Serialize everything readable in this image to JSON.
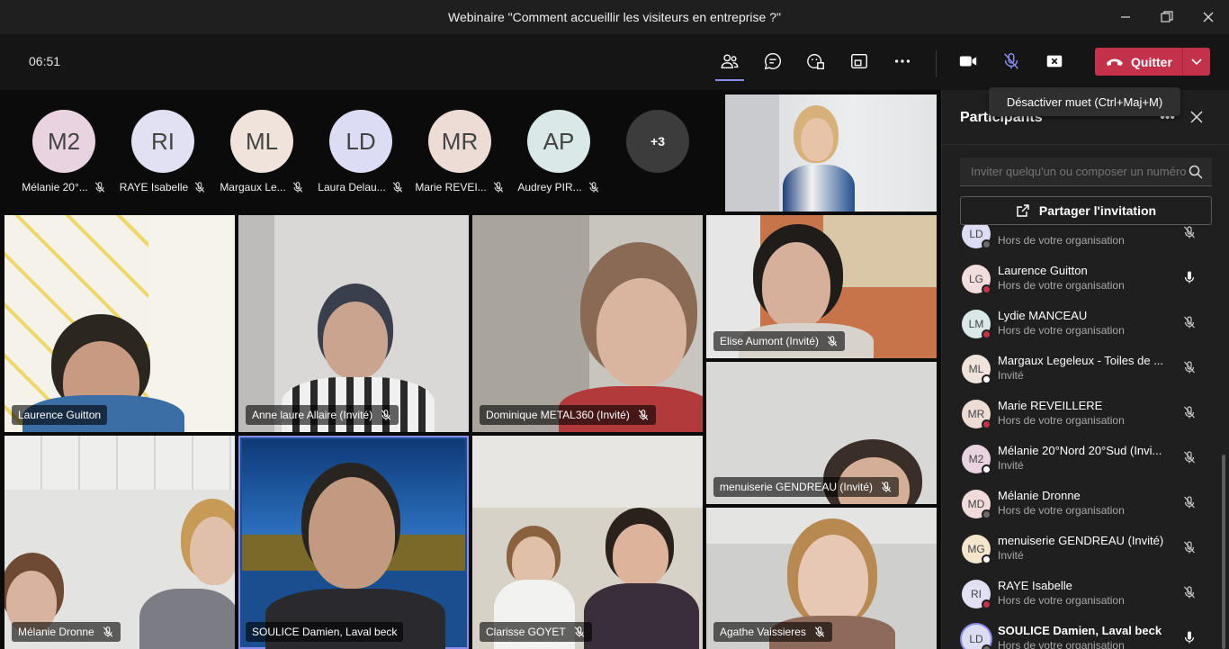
{
  "window": {
    "title": "Webinaire \"Comment accueillir les visiteurs en entreprise ?\""
  },
  "toolbar": {
    "timer": "06:51",
    "quit_label": "Quitter",
    "tooltip": "Désactiver muet (Ctrl+Maj+M)"
  },
  "avatars": [
    {
      "initials": "M2",
      "name": "Mélanie 20°...",
      "color": "#ead3e0"
    },
    {
      "initials": "RI",
      "name": "RAYE Isabelle",
      "color": "#e2e0f3"
    },
    {
      "initials": "ML",
      "name": "Margaux Le...",
      "color": "#efe3dc"
    },
    {
      "initials": "LD",
      "name": "Laura Delau...",
      "color": "#dcdcf4"
    },
    {
      "initials": "MR",
      "name": "Marie REVEI...",
      "color": "#eddcd6"
    },
    {
      "initials": "AP",
      "name": "Audrey PIR...",
      "color": "#dbe8e8"
    }
  ],
  "more_count": "+3",
  "tiles": [
    {
      "name": "Laurence Guitton"
    },
    {
      "name": "Anne laure Allaire (Invité)"
    },
    {
      "name": "Dominique METAL360 (Invité)"
    },
    {
      "name": "Elise Aumont (Invité)"
    },
    {
      "name": "menuiserie GENDREAU (Invité)"
    },
    {
      "name": "Mélanie Dronne"
    },
    {
      "name": "SOULICE Damien, Laval beck"
    },
    {
      "name": "Clarisse GOYET"
    },
    {
      "name": "Agathe Vaissieres"
    }
  ],
  "panel": {
    "title": "Participants",
    "invite_placeholder": "Inviter quelqu'un ou composer un numéro",
    "share_label": "Partager l'invitation",
    "participants": [
      {
        "initials": "LD",
        "name": "",
        "sub": "Hors de votre organisation",
        "avcolor": "#dcdcf4",
        "dot": "#6b6b6b",
        "mic": "off"
      },
      {
        "initials": "LG",
        "name": "Laurence Guitton",
        "sub": "Hors de votre organisation",
        "avcolor": "#f3dcdc",
        "dot": "#c4314b",
        "mic": "on"
      },
      {
        "initials": "LM",
        "name": "Lydie MANCEAU",
        "sub": "Hors de votre organisation",
        "avcolor": "#dbe8e8",
        "dot": "#c4314b",
        "mic": "off"
      },
      {
        "initials": "ML",
        "name": "Margaux Legeleux - Toiles de ...",
        "sub": "Invité",
        "avcolor": "#efe3dc",
        "dot": "#ffffff",
        "mic": "off"
      },
      {
        "initials": "MR",
        "name": "Marie REVEILLERE",
        "sub": "Hors de votre organisation",
        "avcolor": "#eddcd6",
        "dot": "#c4314b",
        "mic": "off"
      },
      {
        "initials": "M2",
        "name": "Mélanie 20°Nord 20°Sud (Invi...",
        "sub": "Invité",
        "avcolor": "#ead3e0",
        "dot": "#ffffff",
        "mic": "off"
      },
      {
        "initials": "MD",
        "name": "Mélanie Dronne",
        "sub": "Hors de votre organisation",
        "avcolor": "#f0dada",
        "dot": "#6b6b6b",
        "mic": "off"
      },
      {
        "initials": "MG",
        "name": "menuiserie GENDREAU (Invité)",
        "sub": "Invité",
        "avcolor": "#f3e6cc",
        "dot": "#ffffff",
        "mic": "off"
      },
      {
        "initials": "RI",
        "name": "RAYE Isabelle",
        "sub": "Hors de votre organisation",
        "avcolor": "#e2e0f3",
        "dot": "#c4314b",
        "mic": "off"
      },
      {
        "initials": "LD",
        "name": "SOULICE Damien, Laval beck",
        "sub": "Hors de votre organisation",
        "avcolor": "#dcdcf4",
        "dot": "#6b6b6b",
        "mic": "on"
      }
    ]
  },
  "colors": {
    "accent": "#8b8cf0",
    "danger": "#c4314b"
  }
}
